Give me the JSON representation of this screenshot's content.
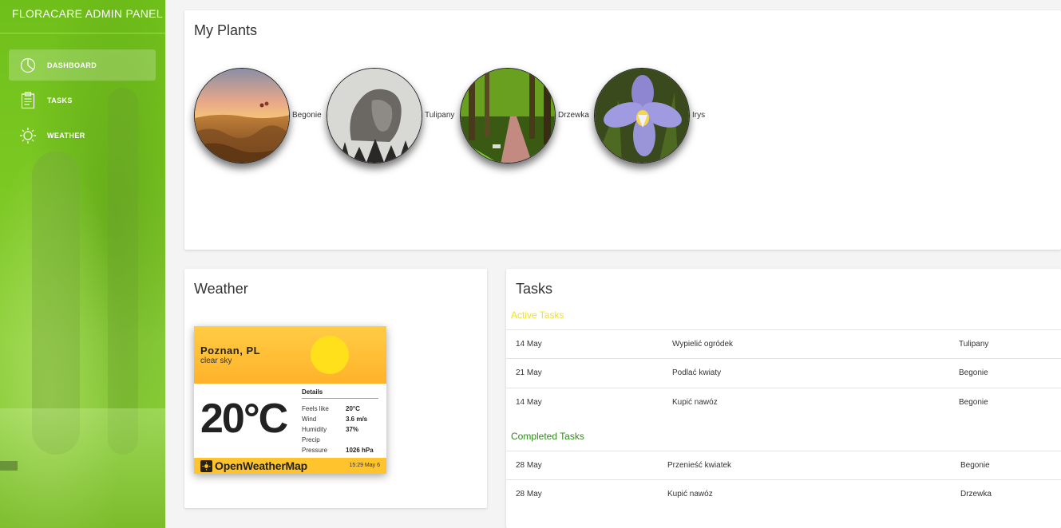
{
  "app": {
    "title": "FLORACARE ADMIN PANEL"
  },
  "sidebar": {
    "items": [
      {
        "label": "DASHBOARD",
        "icon": "pie-chart-icon",
        "active": true
      },
      {
        "label": "TASKS",
        "icon": "clipboard-icon",
        "active": false
      },
      {
        "label": "WEATHER",
        "icon": "sun-icon",
        "active": false
      }
    ]
  },
  "plants": {
    "title": "My Plants",
    "items": [
      {
        "name": "Begonie",
        "image": "hot-air-balloons-landscape"
      },
      {
        "name": "Tulipany",
        "image": "double-exposure-portrait-forest"
      },
      {
        "name": "Drzewka",
        "image": "park-alley-trees"
      },
      {
        "name": "Irys",
        "image": "purple-iris-flower"
      }
    ]
  },
  "weather": {
    "title": "Weather",
    "widget": {
      "city": "Poznan, PL",
      "description": "clear sky",
      "temperature": "20°C",
      "details_title": "Details",
      "details": [
        {
          "label": "Feels like",
          "value": "20°C"
        },
        {
          "label": "Wind",
          "value": "3.6 m/s"
        },
        {
          "label": "Humidity",
          "value": "37%"
        },
        {
          "label": "Precip",
          "value": ""
        },
        {
          "label": "Pressure",
          "value": "1026 hPa"
        }
      ],
      "brand": "OpenWeatherMap",
      "timestamp": "15:29 May 6"
    }
  },
  "tasks": {
    "title": "Tasks",
    "active_label": "Active Tasks",
    "completed_label": "Completed Tasks",
    "active": [
      {
        "date": "14 May",
        "task": "Wypielić ogródek",
        "plant": "Tulipany"
      },
      {
        "date": "21 May",
        "task": "Podlać kwiaty",
        "plant": "Begonie"
      },
      {
        "date": "14 May",
        "task": "Kupić nawóz",
        "plant": "Begonie"
      }
    ],
    "completed": [
      {
        "date": "28 May",
        "task": "Przenieść kwiatek",
        "plant": "Begonie"
      },
      {
        "date": "28 May",
        "task": "Kupić nawóz",
        "plant": "Drzewka"
      }
    ]
  },
  "colors": {
    "sidebar_green": "#7cc823",
    "active_tasks": "#f7e01b",
    "completed_tasks": "#2e8b1a",
    "owm_yellow": "#ffc32e"
  }
}
